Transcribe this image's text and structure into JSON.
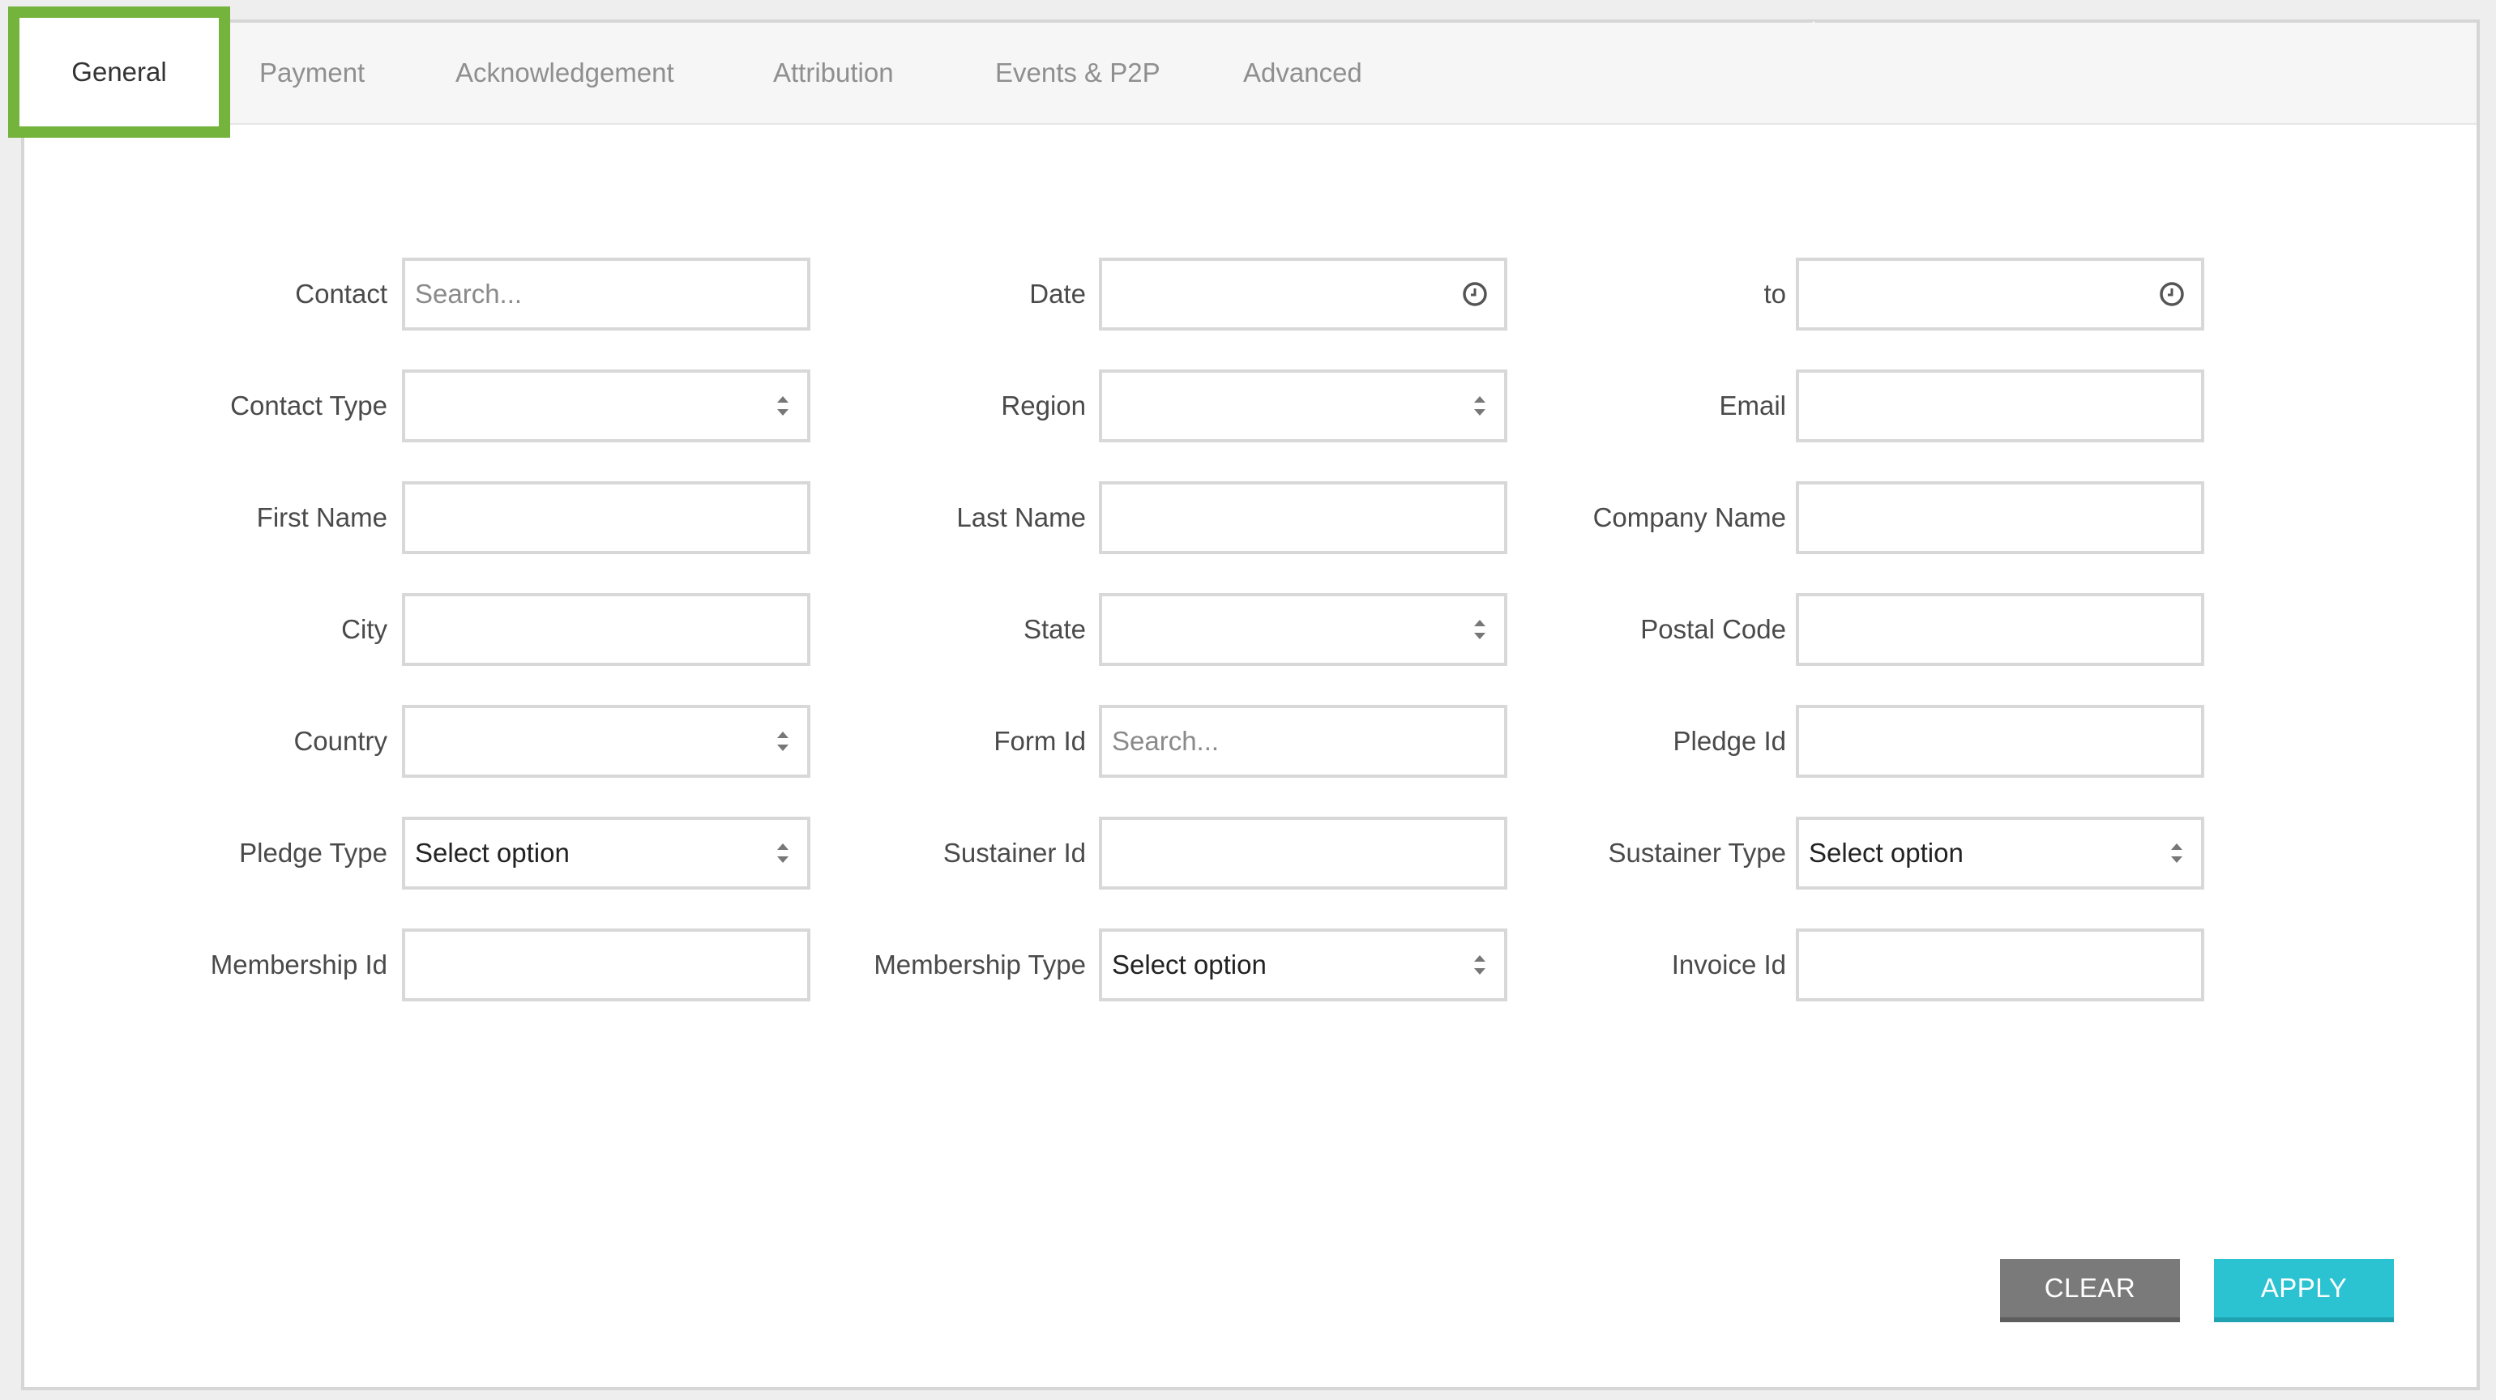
{
  "tabs": [
    "General",
    "Payment",
    "Acknowledgement",
    "Attribution",
    "Events & P2P",
    "Advanced"
  ],
  "fields": {
    "contact": {
      "label": "Contact",
      "placeholder": "Search...",
      "value": ""
    },
    "date": {
      "label": "Date",
      "value": ""
    },
    "date_to": {
      "label": "to",
      "value": ""
    },
    "contact_type": {
      "label": "Contact Type",
      "value": ""
    },
    "region": {
      "label": "Region",
      "value": ""
    },
    "email": {
      "label": "Email",
      "value": ""
    },
    "first_name": {
      "label": "First Name",
      "value": ""
    },
    "last_name": {
      "label": "Last Name",
      "value": ""
    },
    "company_name": {
      "label": "Company Name",
      "value": ""
    },
    "city": {
      "label": "City",
      "value": ""
    },
    "state": {
      "label": "State",
      "value": ""
    },
    "postal_code": {
      "label": "Postal Code",
      "value": ""
    },
    "country": {
      "label": "Country",
      "value": ""
    },
    "form_id": {
      "label": "Form Id",
      "placeholder": "Search...",
      "value": ""
    },
    "pledge_id": {
      "label": "Pledge Id",
      "value": ""
    },
    "pledge_type": {
      "label": "Pledge Type",
      "value": "Select option"
    },
    "sustainer_id": {
      "label": "Sustainer Id",
      "value": ""
    },
    "sustainer_type": {
      "label": "Sustainer Type",
      "value": "Select option"
    },
    "membership_id": {
      "label": "Membership Id",
      "value": ""
    },
    "membership_type": {
      "label": "Membership Type",
      "value": "Select option"
    },
    "invoice_id": {
      "label": "Invoice Id",
      "value": ""
    }
  },
  "buttons": {
    "clear": "CLEAR",
    "apply": "APPLY"
  },
  "colors": {
    "active_tab_highlight": "#74b33c",
    "apply": "#2bc3d2",
    "clear": "#7a7a7a"
  }
}
